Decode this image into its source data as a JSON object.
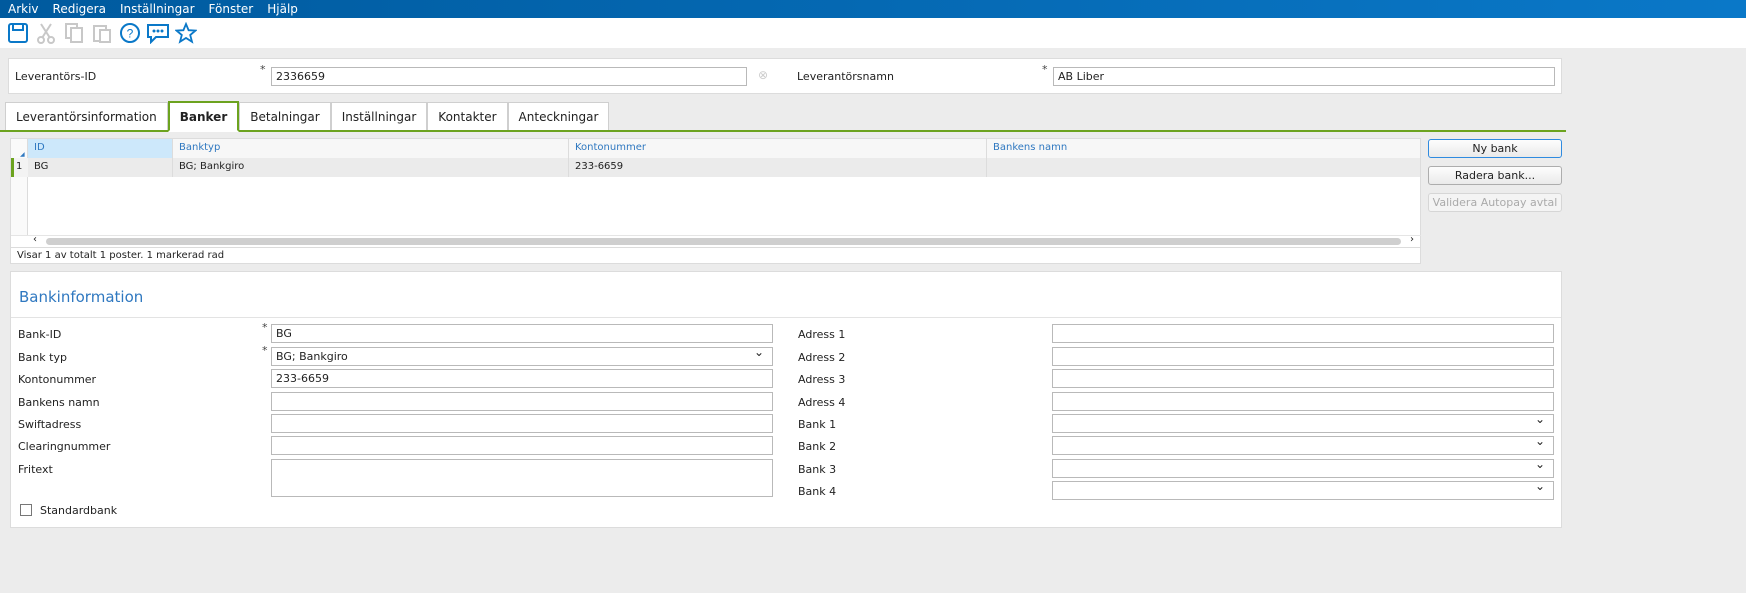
{
  "menu": [
    "Arkiv",
    "Redigera",
    "Inställningar",
    "Fönster",
    "Hjälp"
  ],
  "header": {
    "id_label": "Leverantörs-ID",
    "id_value": "2336659",
    "name_label": "Leverantörsnamn",
    "name_value": "AB Liber",
    "required": "*"
  },
  "tabs": [
    "Leverantörsinformation",
    "Banker",
    "Betalningar",
    "Inställningar",
    "Kontakter",
    "Anteckningar"
  ],
  "grid": {
    "columns": [
      "ID",
      "Banktyp",
      "Kontonummer",
      "Bankens namn"
    ],
    "rows": [
      {
        "num": "1",
        "cells": [
          "BG",
          "BG; Bankgiro",
          "233-6659",
          ""
        ]
      }
    ],
    "status": "Visar 1 av totalt 1 poster. 1 markerad rad"
  },
  "buttons": {
    "new": "Ny bank",
    "delete": "Radera bank...",
    "validate": "Validera Autopay avtal"
  },
  "bankinfo": {
    "title": "Bankinformation",
    "left": [
      {
        "label": "Bank-ID",
        "value": "BG",
        "req": "*"
      },
      {
        "label": "Bank typ",
        "value": "BG; Bankgiro",
        "req": "*"
      },
      {
        "label": "Kontonummer",
        "value": "233-6659"
      },
      {
        "label": "Bankens namn",
        "value": ""
      },
      {
        "label": "Swiftadress",
        "value": ""
      },
      {
        "label": "Clearingnummer",
        "value": ""
      },
      {
        "label": "Fritext",
        "value": ""
      }
    ],
    "right": [
      {
        "label": "Adress 1",
        "value": ""
      },
      {
        "label": "Adress 2",
        "value": ""
      },
      {
        "label": "Adress 3",
        "value": ""
      },
      {
        "label": "Adress 4",
        "value": ""
      },
      {
        "label": "Bank 1",
        "value": ""
      },
      {
        "label": "Bank 2",
        "value": ""
      },
      {
        "label": "Bank 3",
        "value": ""
      },
      {
        "label": "Bank 4",
        "value": ""
      }
    ],
    "standard_label": "Standardbank",
    "standard_checked": false
  },
  "colors": {
    "accent": "#0a78c8",
    "tab_active": "#6ca31f"
  }
}
